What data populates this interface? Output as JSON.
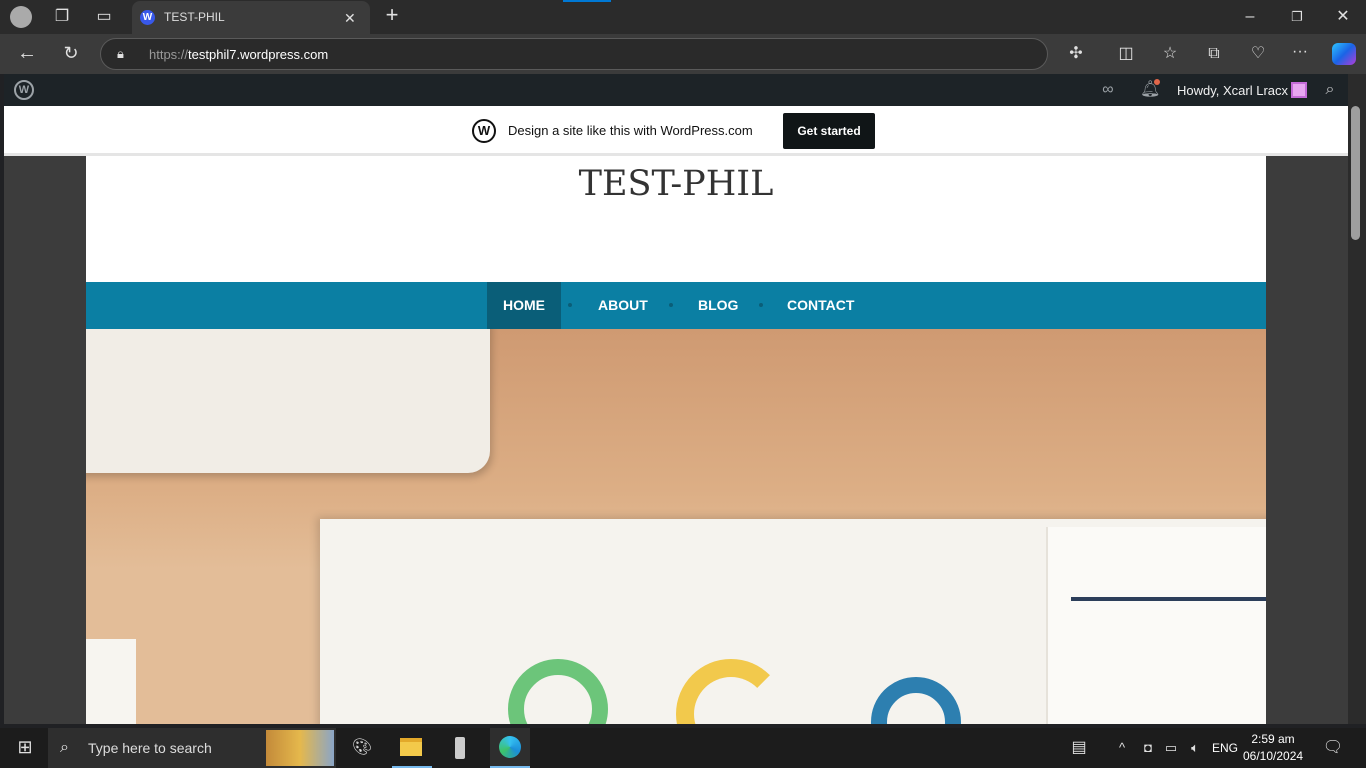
{
  "browser": {
    "tab_title": "TEST-PHIL",
    "url_scheme": "https://",
    "url_host": "testphil7.wordpress.com"
  },
  "wp_admin_bar": {
    "greeting": "Howdy, Xcarl Lracx"
  },
  "banner": {
    "text": "Design a site like this with WordPress.com",
    "button": "Get started"
  },
  "site": {
    "title": "TEST-PHIL",
    "nav": [
      {
        "label": "HOME",
        "active": true
      },
      {
        "label": "ABOUT"
      },
      {
        "label": "BLOG"
      },
      {
        "label": "CONTACT"
      }
    ],
    "accent": "#0b7fa3"
  },
  "taskbar": {
    "search_placeholder": "Type here to search",
    "lang": "ENG",
    "time": "2:59 am",
    "date": "06/10/2024"
  }
}
